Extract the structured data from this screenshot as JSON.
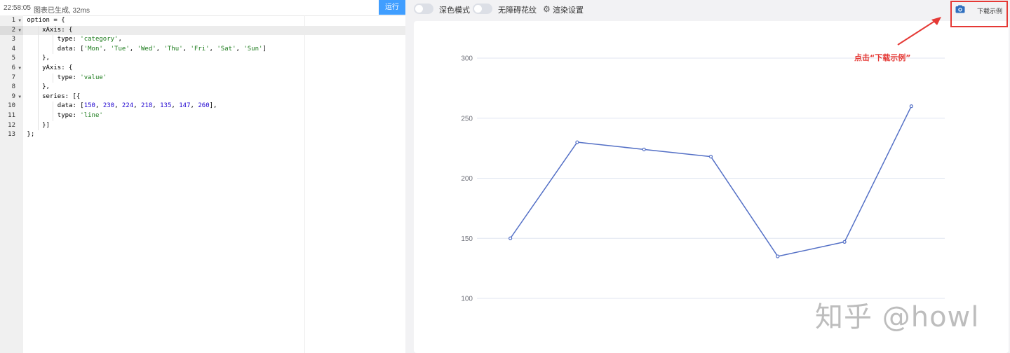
{
  "status_bar": {
    "time": "22:58:05",
    "message": "图表已生成, 32ms",
    "run_label": "运行"
  },
  "editor": {
    "lines": [
      {
        "num": "1",
        "fold": true,
        "code": [
          {
            "t": "option = {",
            "c": ""
          }
        ]
      },
      {
        "num": "2",
        "fold": true,
        "active": true,
        "code": [
          {
            "t": "    xAxis: {",
            "c": ""
          }
        ]
      },
      {
        "num": "3",
        "code": [
          {
            "t": "        type: ",
            "c": ""
          },
          {
            "t": "'category'",
            "c": "str"
          },
          {
            "t": ",",
            "c": ""
          }
        ]
      },
      {
        "num": "4",
        "code": [
          {
            "t": "        data: [",
            "c": ""
          },
          {
            "t": "'Mon'",
            "c": "str"
          },
          {
            "t": ", ",
            "c": ""
          },
          {
            "t": "'Tue'",
            "c": "str"
          },
          {
            "t": ", ",
            "c": ""
          },
          {
            "t": "'Wed'",
            "c": "str"
          },
          {
            "t": ", ",
            "c": ""
          },
          {
            "t": "'Thu'",
            "c": "str"
          },
          {
            "t": ", ",
            "c": ""
          },
          {
            "t": "'Fri'",
            "c": "str"
          },
          {
            "t": ", ",
            "c": ""
          },
          {
            "t": "'Sat'",
            "c": "str"
          },
          {
            "t": ", ",
            "c": ""
          },
          {
            "t": "'Sun'",
            "c": "str"
          },
          {
            "t": "]",
            "c": ""
          }
        ]
      },
      {
        "num": "5",
        "code": [
          {
            "t": "    },",
            "c": ""
          }
        ]
      },
      {
        "num": "6",
        "fold": true,
        "code": [
          {
            "t": "    yAxis: {",
            "c": ""
          }
        ]
      },
      {
        "num": "7",
        "code": [
          {
            "t": "        type: ",
            "c": ""
          },
          {
            "t": "'value'",
            "c": "str"
          }
        ]
      },
      {
        "num": "8",
        "code": [
          {
            "t": "    },",
            "c": ""
          }
        ]
      },
      {
        "num": "9",
        "fold": true,
        "code": [
          {
            "t": "    series: [{",
            "c": ""
          }
        ]
      },
      {
        "num": "10",
        "code": [
          {
            "t": "        data: [",
            "c": ""
          },
          {
            "t": "150",
            "c": "num"
          },
          {
            "t": ", ",
            "c": ""
          },
          {
            "t": "230",
            "c": "num"
          },
          {
            "t": ", ",
            "c": ""
          },
          {
            "t": "224",
            "c": "num"
          },
          {
            "t": ", ",
            "c": ""
          },
          {
            "t": "218",
            "c": "num"
          },
          {
            "t": ", ",
            "c": ""
          },
          {
            "t": "135",
            "c": "num"
          },
          {
            "t": ", ",
            "c": ""
          },
          {
            "t": "147",
            "c": "num"
          },
          {
            "t": ", ",
            "c": ""
          },
          {
            "t": "260",
            "c": "num"
          },
          {
            "t": "],",
            "c": ""
          }
        ]
      },
      {
        "num": "11",
        "code": [
          {
            "t": "        type: ",
            "c": ""
          },
          {
            "t": "'line'",
            "c": "str"
          }
        ]
      },
      {
        "num": "12",
        "code": [
          {
            "t": "    }]",
            "c": ""
          }
        ]
      },
      {
        "num": "13",
        "code": [
          {
            "t": "};",
            "c": ""
          }
        ]
      }
    ]
  },
  "toolbar": {
    "dark_mode_label": "深色模式",
    "accessibility_label": "无障碍花纹",
    "render_settings_label": "渲染设置",
    "download_label": "下载示例"
  },
  "annotation": {
    "text": "点击“下载示例”",
    "color": "#e53935"
  },
  "watermark": "知乎 @howl",
  "colors": {
    "line": "#5470c6",
    "run_button": "#409eff",
    "grid": "#e0e6f1"
  },
  "chart_data": {
    "type": "line",
    "categories": [
      "Mon",
      "Tue",
      "Wed",
      "Thu",
      "Fri",
      "Sat",
      "Sun"
    ],
    "values": [
      150,
      230,
      224,
      218,
      135,
      147,
      260
    ],
    "y_ticks": [
      100,
      150,
      200,
      250,
      300
    ],
    "ylim": [
      100,
      300
    ],
    "grid": true,
    "legend": "none"
  }
}
